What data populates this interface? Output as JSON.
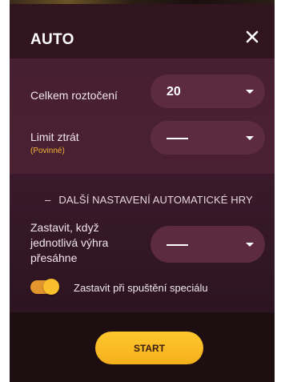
{
  "dialog": {
    "title": "AUTO",
    "close_icon": "close-icon"
  },
  "spins": {
    "label": "Celkem roztočení",
    "value": "20"
  },
  "loss_limit": {
    "label": "Limit ztrát",
    "required_note": "(Povinné)",
    "value": "-----"
  },
  "advanced": {
    "toggle_symbol": "–",
    "title": "DALŠÍ NASTAVENÍ AUTOMATICKÉ HRY",
    "single_win_label": "Zastavit, když jednotlivá výhra přesáhne",
    "single_win_value": "-----",
    "stop_on_feature_label": "Zastavit při spuštění speciálu",
    "stop_on_feature_enabled": true
  },
  "footer": {
    "start_label": "START"
  },
  "colors": {
    "accent": "#fbbe2c",
    "panel": "#461f30",
    "required_note": "#f5b43a"
  }
}
